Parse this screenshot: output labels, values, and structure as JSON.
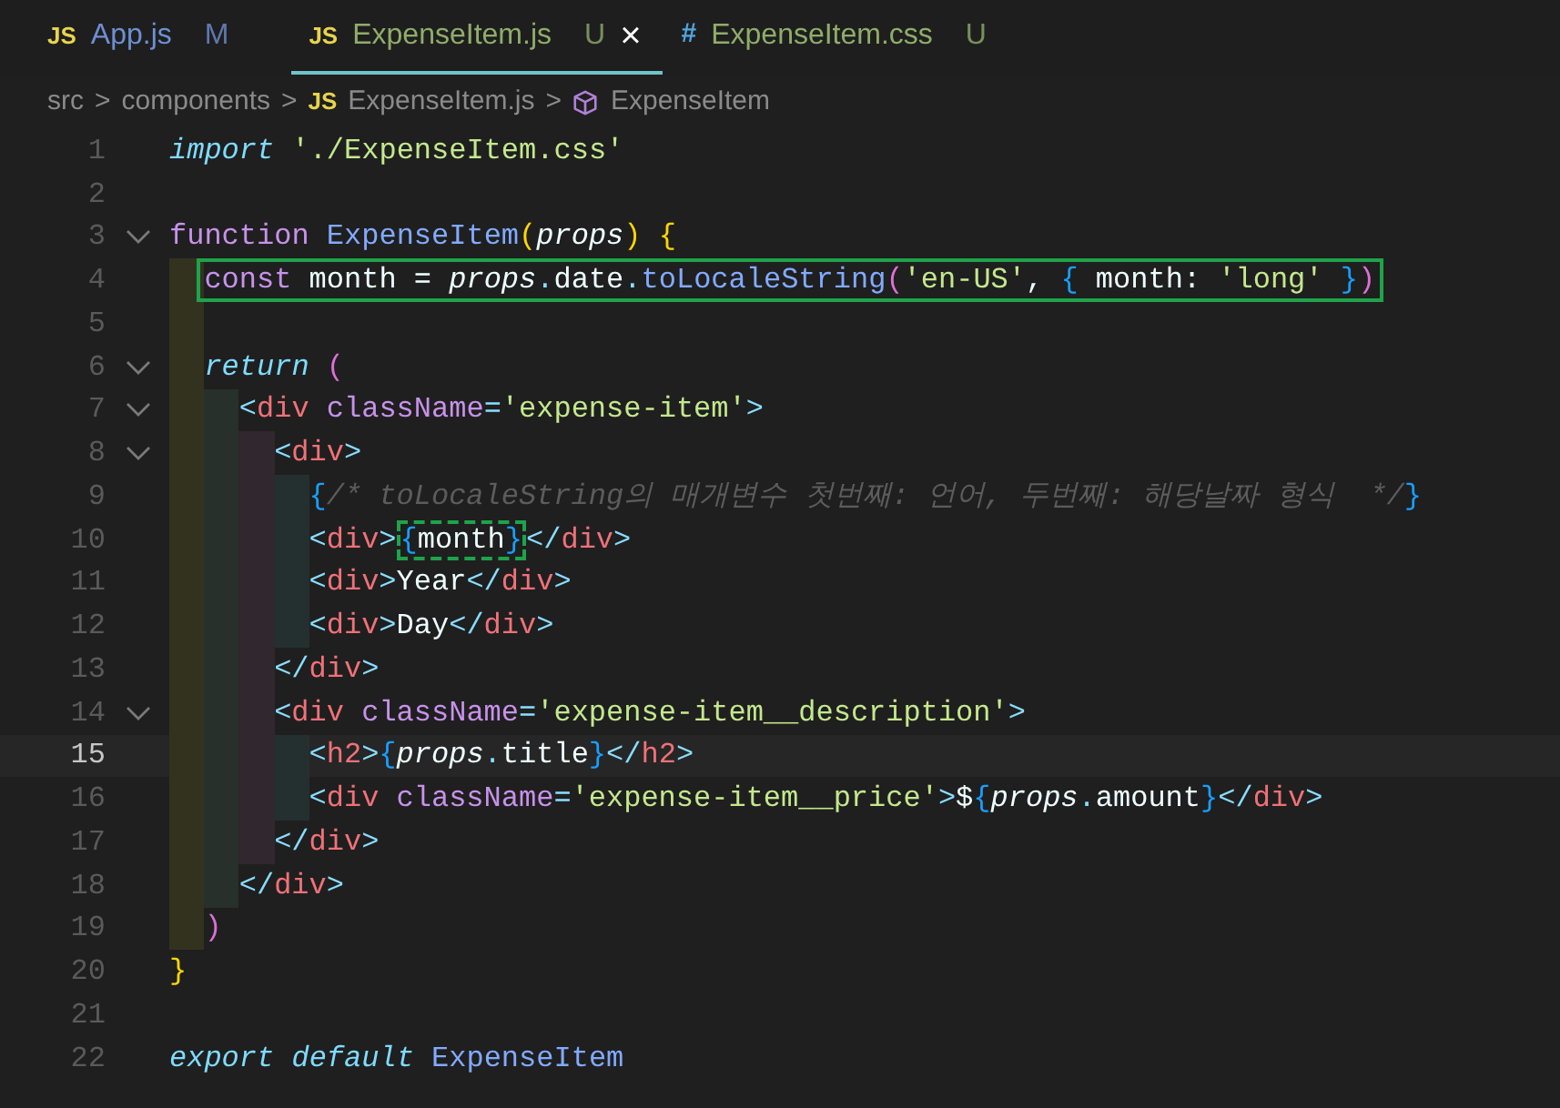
{
  "tabs": [
    {
      "icon": "JS",
      "kind": "js",
      "label": "App.js",
      "status": "M",
      "color": "#6d8fd4",
      "selected": false
    },
    {
      "icon": "JS",
      "kind": "js",
      "label": "ExpenseItem.js",
      "status": "U",
      "color": "#8fad6a",
      "selected": true,
      "close": "×"
    },
    {
      "icon": "#",
      "kind": "css",
      "label": "ExpenseItem.css",
      "status": "U",
      "color": "#8fad6a",
      "selected": false
    }
  ],
  "breadcrumb": [
    {
      "kind": "folder",
      "label": "src"
    },
    {
      "kind": "folder",
      "label": "components"
    },
    {
      "kind": "file",
      "icon": "JS",
      "label": "ExpenseItem.js"
    },
    {
      "kind": "symbol",
      "label": "ExpenseItem"
    }
  ],
  "separator": ">",
  "lines": [
    {
      "number": "1",
      "tokens": [
        {
          "text": "import",
          "kind": "keyword"
        },
        {
          "text": " './ExpenseItem.css'",
          "kind": "string"
        }
      ]
    },
    {
      "number": "2"
    },
    {
      "number": "3",
      "fold": true,
      "tokens": [
        {
          "text": "function",
          "kind": "storage"
        },
        {
          "text": " ExpenseItem",
          "kind": "func"
        },
        {
          "text": "(",
          "kind": "b1"
        },
        {
          "text": "props",
          "kind": "param"
        },
        {
          "text": ") {",
          "kind": "b1"
        }
      ]
    },
    {
      "number": "4",
      "boxed": true,
      "tokens": [
        {
          "text": "  const",
          "kind": "storage"
        },
        {
          "text": " month = ",
          "kind": "plain"
        },
        {
          "text": "props",
          "kind": "param"
        },
        {
          "text": ".",
          "kind": "punct"
        },
        {
          "text": "date",
          "kind": "plain"
        },
        {
          "text": ".",
          "kind": "punct"
        },
        {
          "text": "toLocaleString",
          "kind": "func"
        },
        {
          "text": "(",
          "kind": "b2"
        },
        {
          "text": "'en-US'",
          "kind": "string"
        },
        {
          "text": ", ",
          "kind": "plain"
        },
        {
          "text": "{",
          "kind": "b3"
        },
        {
          "text": " month: ",
          "kind": "plain"
        },
        {
          "text": "'long'",
          "kind": "string"
        },
        {
          "text": " }",
          "kind": "b3"
        },
        {
          "text": ")",
          "kind": "b2"
        }
      ]
    },
    {
      "number": "5"
    },
    {
      "number": "6",
      "fold": true,
      "tokens": [
        {
          "text": "  return",
          "kind": "keyword"
        },
        {
          "text": " (",
          "kind": "b2"
        }
      ]
    },
    {
      "number": "7",
      "fold": true,
      "tokens": [
        {
          "text": "    <",
          "kind": "punct"
        },
        {
          "text": "div",
          "kind": "tag"
        },
        {
          "text": " className",
          "kind": "attr"
        },
        {
          "text": "=",
          "kind": "punct"
        },
        {
          "text": "'expense-item'",
          "kind": "string"
        },
        {
          "text": ">",
          "kind": "punct"
        }
      ]
    },
    {
      "number": "8",
      "fold": true,
      "tokens": [
        {
          "text": "      <",
          "kind": "punct"
        },
        {
          "text": "div",
          "kind": "tag"
        },
        {
          "text": ">",
          "kind": "punct"
        }
      ]
    },
    {
      "number": "9",
      "tokens": [
        {
          "text": "        {",
          "kind": "b3"
        },
        {
          "text": "/* toLocaleString의 매개변수 첫번째: 언어, 두번째: 해당날짜 형식  */",
          "kind": "comment"
        },
        {
          "text": "}",
          "kind": "b3"
        }
      ]
    },
    {
      "number": "10",
      "tokens": [
        {
          "text": "        <",
          "kind": "punct"
        },
        {
          "text": "div",
          "kind": "tag"
        },
        {
          "text": ">",
          "kind": "punct"
        },
        {
          "text": "{",
          "kind": "b3",
          "boxed": true
        },
        {
          "text": "month",
          "kind": "plain",
          "boxed": true
        },
        {
          "text": "}",
          "kind": "b3",
          "boxed": true
        },
        {
          "text": "</",
          "kind": "punct"
        },
        {
          "text": "div",
          "kind": "tag"
        },
        {
          "text": ">",
          "kind": "punct"
        }
      ]
    },
    {
      "number": "11",
      "tokens": [
        {
          "text": "        <",
          "kind": "punct"
        },
        {
          "text": "div",
          "kind": "tag"
        },
        {
          "text": ">",
          "kind": "punct"
        },
        {
          "text": "Year",
          "kind": "plain"
        },
        {
          "text": "</",
          "kind": "punct"
        },
        {
          "text": "div",
          "kind": "tag"
        },
        {
          "text": ">",
          "kind": "punct"
        }
      ]
    },
    {
      "number": "12",
      "tokens": [
        {
          "text": "        <",
          "kind": "punct"
        },
        {
          "text": "div",
          "kind": "tag"
        },
        {
          "text": ">",
          "kind": "punct"
        },
        {
          "text": "Day",
          "kind": "plain"
        },
        {
          "text": "</",
          "kind": "punct"
        },
        {
          "text": "div",
          "kind": "tag"
        },
        {
          "text": ">",
          "kind": "punct"
        }
      ]
    },
    {
      "number": "13",
      "tokens": [
        {
          "text": "      </",
          "kind": "punct"
        },
        {
          "text": "div",
          "kind": "tag"
        },
        {
          "text": ">",
          "kind": "punct"
        }
      ]
    },
    {
      "number": "14",
      "fold": true,
      "tokens": [
        {
          "text": "      <",
          "kind": "punct"
        },
        {
          "text": "div",
          "kind": "tag"
        },
        {
          "text": " className",
          "kind": "attr"
        },
        {
          "text": "=",
          "kind": "punct"
        },
        {
          "text": "'expense-item__description'",
          "kind": "string"
        },
        {
          "text": ">",
          "kind": "punct"
        }
      ]
    },
    {
      "number": "15",
      "current": true,
      "tokens": [
        {
          "text": "        <",
          "kind": "punct"
        },
        {
          "text": "h2",
          "kind": "tag"
        },
        {
          "text": ">",
          "kind": "punct"
        },
        {
          "text": "{",
          "kind": "b3"
        },
        {
          "text": "props",
          "kind": "param"
        },
        {
          "text": ".",
          "kind": "punct"
        },
        {
          "text": "title",
          "kind": "plain"
        },
        {
          "text": "}",
          "kind": "b3"
        },
        {
          "text": "</",
          "kind": "punct"
        },
        {
          "text": "h2",
          "kind": "tag"
        },
        {
          "text": ">",
          "kind": "punct"
        }
      ]
    },
    {
      "number": "16",
      "tokens": [
        {
          "text": "        <",
          "kind": "punct"
        },
        {
          "text": "div",
          "kind": "tag"
        },
        {
          "text": " className",
          "kind": "attr"
        },
        {
          "text": "=",
          "kind": "punct"
        },
        {
          "text": "'expense-item__price'",
          "kind": "string"
        },
        {
          "text": ">",
          "kind": "punct"
        },
        {
          "text": "$",
          "kind": "plain"
        },
        {
          "text": "{",
          "kind": "b3"
        },
        {
          "text": "props",
          "kind": "param"
        },
        {
          "text": ".",
          "kind": "punct"
        },
        {
          "text": "amount",
          "kind": "plain"
        },
        {
          "text": "}",
          "kind": "b3"
        },
        {
          "text": "</",
          "kind": "punct"
        },
        {
          "text": "div",
          "kind": "tag"
        },
        {
          "text": ">",
          "kind": "punct"
        }
      ]
    },
    {
      "number": "17",
      "tokens": [
        {
          "text": "      </",
          "kind": "punct"
        },
        {
          "text": "div",
          "kind": "tag"
        },
        {
          "text": ">",
          "kind": "punct"
        }
      ]
    },
    {
      "number": "18",
      "tokens": [
        {
          "text": "    </",
          "kind": "punct"
        },
        {
          "text": "div",
          "kind": "tag"
        },
        {
          "text": ">",
          "kind": "punct"
        }
      ]
    },
    {
      "number": "19",
      "tokens": [
        {
          "text": "  )",
          "kind": "b2"
        }
      ]
    },
    {
      "number": "20",
      "tokens": [
        {
          "text": "}",
          "kind": "b1"
        }
      ]
    },
    {
      "number": "21"
    },
    {
      "number": "22",
      "tokens": [
        {
          "text": "export default",
          "kind": "keyword"
        },
        {
          "text": " ExpenseItem",
          "kind": "func"
        }
      ]
    }
  ]
}
